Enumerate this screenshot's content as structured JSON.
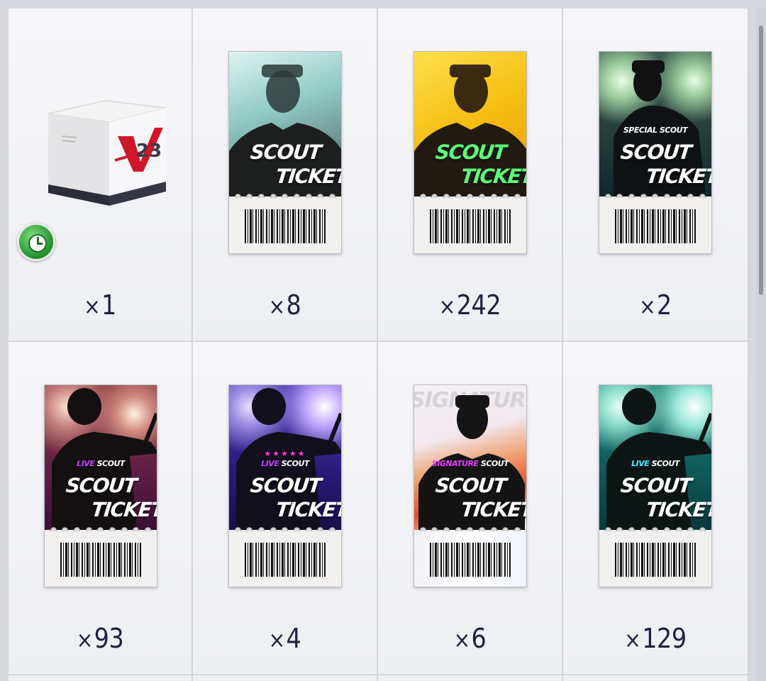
{
  "items": [
    {
      "count": "1",
      "kind": "box",
      "box_text": "V",
      "box_sub": "23"
    },
    {
      "count": "8",
      "kind": "ticket",
      "title_1": "SCOUT",
      "title_2": "TICKET",
      "subtitle": "",
      "theme": "teal"
    },
    {
      "count": "242",
      "kind": "ticket",
      "title_1": "SCOUT",
      "title_2": "TICKET",
      "subtitle": "",
      "theme": "gold"
    },
    {
      "count": "2",
      "kind": "ticket",
      "title_1": "SCOUT",
      "title_2": "TICKET",
      "subtitle": "SPECIAL SCOUT",
      "theme": "stadium"
    },
    {
      "count": "93",
      "kind": "ticket",
      "title_1": "SCOUT",
      "title_2": "TICKET",
      "subtitle_hl": "LIVE",
      "subtitle": "SCOUT",
      "theme": "red"
    },
    {
      "count": "4",
      "kind": "ticket",
      "title_1": "SCOUT",
      "title_2": "TICKET",
      "subtitle_hl": "LIVE",
      "subtitle": "SCOUT",
      "stars": "★★★★★",
      "theme": "purple"
    },
    {
      "count": "6",
      "kind": "ticket",
      "title_1": "SCOUT",
      "title_2": "TICKET",
      "subtitle_hl": "SIGNATURE",
      "subtitle": "SCOUT",
      "bg_text": "SIGNATURE",
      "theme": "signature"
    },
    {
      "count": "129",
      "kind": "ticket",
      "title_1": "SCOUT",
      "title_2": "TICKET",
      "subtitle_hl": "LIVE",
      "subtitle": "SCOUT",
      "theme": "green"
    }
  ],
  "count_prefix": "×",
  "colors": {
    "teal": "#9fd3cf",
    "gold": "#f2c318",
    "stadium": "#1f3b3a",
    "red": "#8a2b45",
    "purple": "#3c2a8f",
    "signature": "#e07a4a",
    "green": "#138078"
  },
  "icons": {
    "timer": "clock-icon"
  }
}
